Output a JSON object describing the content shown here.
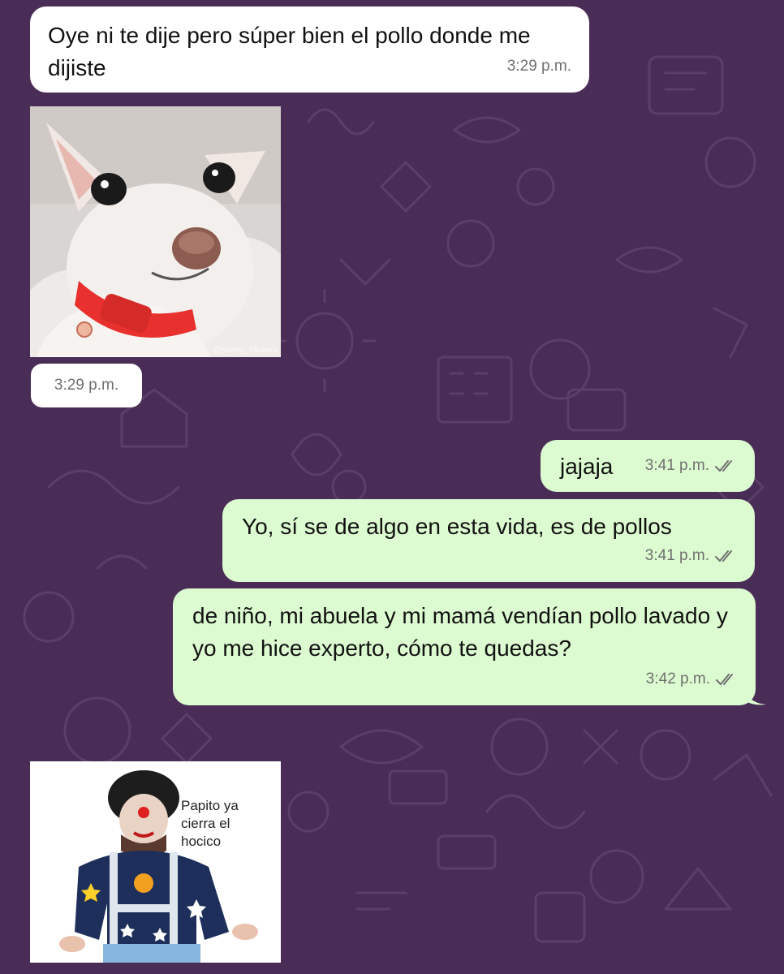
{
  "colors": {
    "wallpaper": "#4a2d57",
    "incoming_bubble": "#ffffff",
    "outgoing_bubble": "#dcfbd0",
    "timestamp": "#6f6f6f",
    "read_ticks": "#6f6f6f"
  },
  "messages": [
    {
      "direction": "incoming",
      "type": "text",
      "text": "Oye ni te dije pero súper bien el pollo donde me dijiste",
      "time": "3:29 p.m."
    },
    {
      "direction": "incoming",
      "type": "sticker",
      "sticker_icon": "chihuahua-sticker",
      "watermark": "@Harley_Stickers",
      "time": "3:29 p.m."
    },
    {
      "direction": "outgoing",
      "type": "text",
      "text": "jajaja",
      "time": "3:41 p.m.",
      "status_icon": "double-check-icon"
    },
    {
      "direction": "outgoing",
      "type": "text",
      "text": "Yo, sí se de algo en esta vida, es de pollos",
      "time": "3:41 p.m.",
      "status_icon": "double-check-icon"
    },
    {
      "direction": "outgoing",
      "type": "text",
      "text": "de niño, mi abuela y mi mamá vendían pollo lavado y yo me hice experto, cómo te quedas?",
      "time": "3:42 p.m.",
      "status_icon": "double-check-icon"
    },
    {
      "direction": "incoming",
      "type": "sticker",
      "sticker_icon": "clown-sticker",
      "caption": "Papito ya cierra el hocico"
    }
  ]
}
